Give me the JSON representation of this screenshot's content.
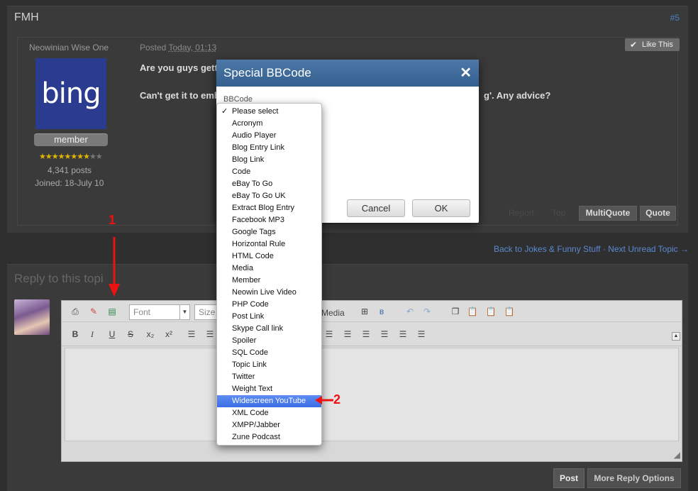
{
  "thread": {
    "title": "FMH",
    "post_number": "#5"
  },
  "post": {
    "user_title": "Neowinian Wise One",
    "avatar_text": "bing",
    "group": "member",
    "stars_filled": 8,
    "stars_total": 10,
    "posts_count": "4,341 posts",
    "joined": "Joined: 18-July 10",
    "posted_prefix": "Posted",
    "posted_time": "Today, 01:13",
    "line1": "Are you guys getti",
    "line2": "Can't get it to emb",
    "line2_tail": "g'. Any advice?",
    "like_label": "Like This",
    "report_label": "Report",
    "top_label": "Top",
    "multiquote_label": "MultiQuote",
    "quote_label": "Quote"
  },
  "nav": {
    "links": "Back to Jokes & Funny Stuff · Next Unread Topic →"
  },
  "reply": {
    "title": "Reply to this topi",
    "font_placeholder": "Font",
    "size_placeholder": "Size",
    "media_label": "Media",
    "post_label": "Post",
    "more_label": "More Reply Options"
  },
  "modal": {
    "title": "Special BBCode",
    "field_label": "BBCode",
    "cancel_label": "Cancel",
    "ok_label": "OK"
  },
  "dropdown": {
    "selected_index": 25,
    "checked_index": 0,
    "items": [
      "Please select",
      "Acronym",
      "Audio Player",
      "Blog Entry Link",
      "Blog Link",
      "Code",
      "eBay To Go",
      "eBay To Go UK",
      "Extract Blog Entry",
      "Facebook MP3",
      "Google Tags",
      "Horizontal Rule",
      "HTML Code",
      "Media",
      "Member",
      "Neowin Live Video",
      "PHP Code",
      "Post Link",
      "Skype Call link",
      "Spoiler",
      "SQL Code",
      "Topic Link",
      "Twitter",
      "Weight Text",
      "Widescreen YouTube",
      "XML Code",
      "XMPP/Jabber",
      "Zune Podcast"
    ]
  },
  "annotations": {
    "step1": "1",
    "step2": "2"
  },
  "colors": {
    "accent_blue": "#3b6ee6",
    "header_blue": "#33608f",
    "annotation_red": "#e11111"
  }
}
